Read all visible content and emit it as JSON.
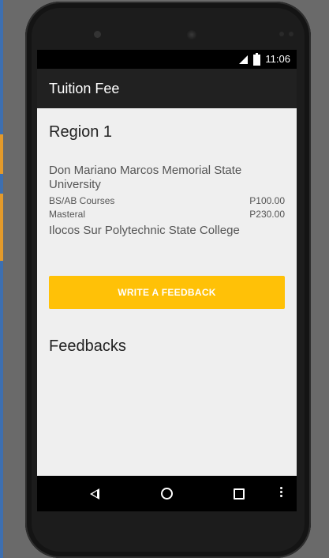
{
  "status_bar": {
    "time": "11:06",
    "icons": [
      "signal-icon",
      "battery-icon"
    ]
  },
  "app_bar": {
    "title": "Tuition Fee"
  },
  "content": {
    "region_title": "Region 1",
    "schools": [
      {
        "name": "Don Mariano Marcos Memorial State University",
        "fees": [
          {
            "label": "BS/AB Courses",
            "amount": "P100.00"
          },
          {
            "label": "Masteral",
            "amount": "P230.00"
          }
        ]
      },
      {
        "name": "Ilocos Sur Polytechnic State College",
        "fees": []
      }
    ],
    "feedback_button_label": "WRITE A FEEDBACK",
    "feedbacks_title": "Feedbacks"
  },
  "nav_bar": {
    "icons": [
      "back-icon",
      "home-icon",
      "recents-icon",
      "menu-icon"
    ]
  },
  "colors": {
    "app_bar": "#212121",
    "accent": "#ffc107",
    "background": "#efefef"
  }
}
